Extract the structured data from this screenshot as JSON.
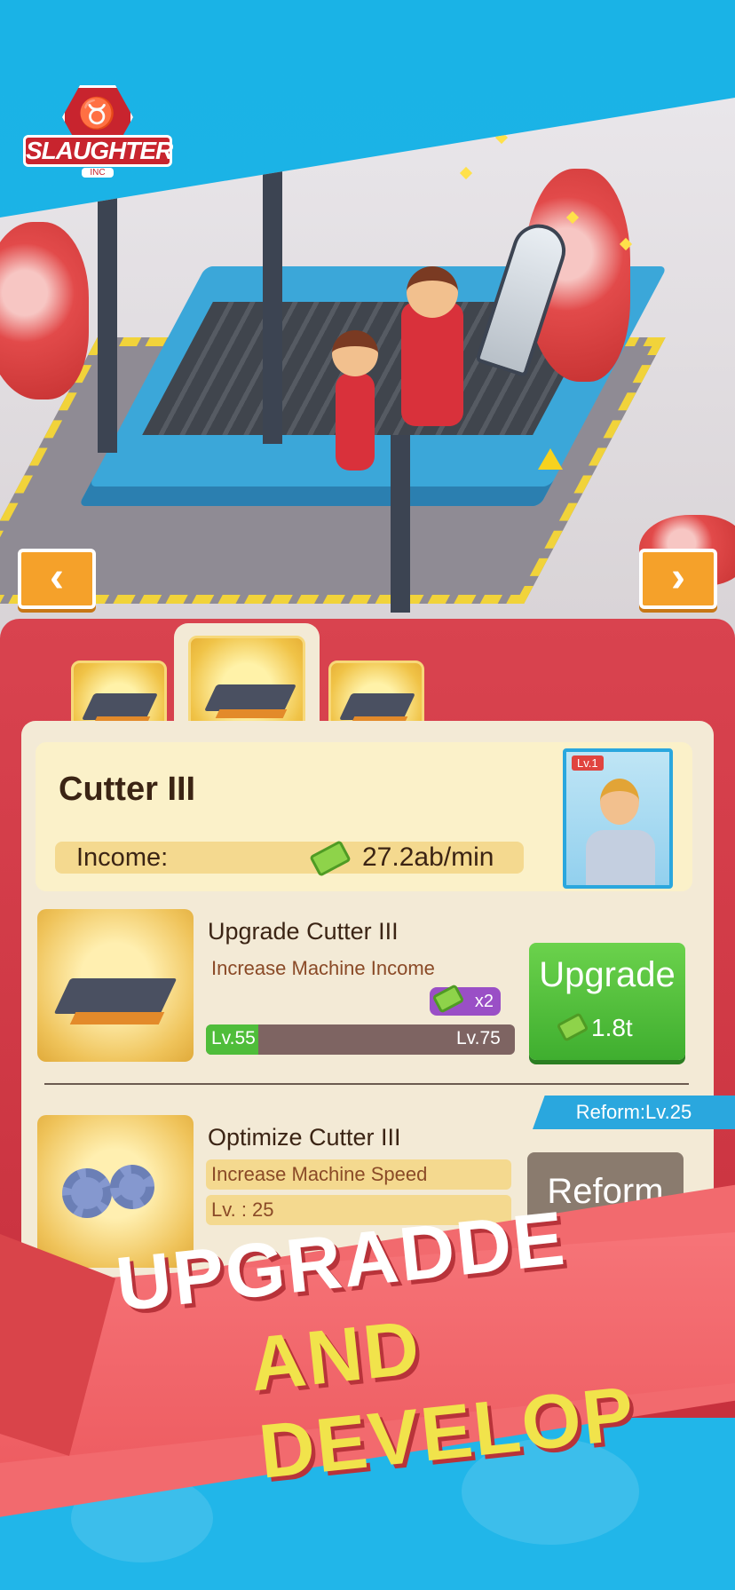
{
  "logo": {
    "brand": "SLAUGHTER",
    "sub": "INC"
  },
  "nav": {
    "prev_glyph": "‹",
    "next_glyph": "›"
  },
  "machine": {
    "name": "Cutter III",
    "income_label": "Income:",
    "income_value": "27.2ab/min"
  },
  "manager": {
    "level": "Lv.1"
  },
  "upgrade_item": {
    "title": "Upgrade Cutter III",
    "description": "Increase Machine Income",
    "multiplier": "x2",
    "level_current": "Lv.55",
    "level_target": "Lv.75",
    "progress_fraction": 0.17,
    "button_label": "Upgrade",
    "button_cost": "1.8t"
  },
  "optimize_item": {
    "reform_requirement": "Reform:Lv.25",
    "title": "Optimize Cutter III",
    "description": "Increase Machine Speed",
    "level": "Lv. : 25",
    "button_label": "Reform"
  },
  "banner": {
    "line1": "UPGRADDE",
    "line2": "AND DEVELOP"
  },
  "colors": {
    "sky": "#1ab3e6",
    "panel_red": "#d9434f",
    "upgrade_green": "#4fbd3a",
    "banner_red": "#f26a6e",
    "banner_yellow": "#f1e34b"
  }
}
